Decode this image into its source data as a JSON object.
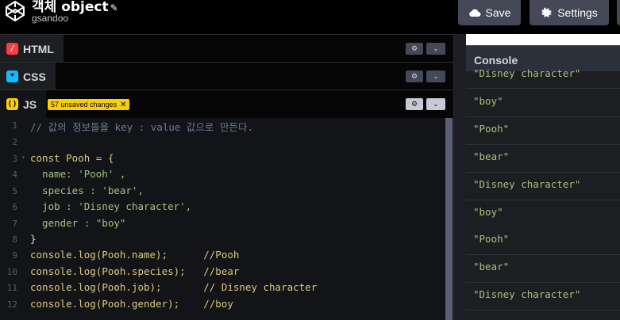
{
  "header": {
    "title": "객체 object",
    "username": "gsandoo",
    "save_label": "Save",
    "settings_label": "Settings"
  },
  "panels": {
    "html": {
      "label": "HTML",
      "icon": "/"
    },
    "css": {
      "label": "CSS",
      "icon": "*"
    },
    "js": {
      "label": "JS",
      "icon": "()",
      "unsaved": "57 unsaved changes"
    }
  },
  "code": {
    "lines": [
      {
        "n": "1",
        "text": "// 값의 정보들을 key : value 값으로 만든다."
      },
      {
        "n": "2",
        "text": ""
      },
      {
        "n": "3",
        "text": "const Pooh = {"
      },
      {
        "n": "4",
        "text": "  name: 'Pooh' ,"
      },
      {
        "n": "5",
        "text": "  species : 'bear',"
      },
      {
        "n": "6",
        "text": "  job : 'Disney character',"
      },
      {
        "n": "7",
        "text": "  gender : \"boy\""
      },
      {
        "n": "8",
        "text": "}"
      },
      {
        "n": "9",
        "text": "console.log(Pooh.name);      //Pooh"
      },
      {
        "n": "10",
        "text": "console.log(Pooh.species);   //bear"
      },
      {
        "n": "11",
        "text": "console.log(Pooh.job);       // Disney character"
      },
      {
        "n": "12",
        "text": "console.log(Pooh.gender);    //boy"
      }
    ]
  },
  "console": {
    "title": "Console",
    "logs": [
      "\"Disney character\"",
      "\"boy\"",
      "\"Pooh\"",
      "\"bear\"",
      "\"Disney character\"",
      "\"boy\"",
      "\"Pooh\"",
      "\"bear\"",
      "\"Disney character\""
    ]
  },
  "colors": {
    "html_icon": "#ff3c41",
    "css_icon": "#0ebeff",
    "js_icon": "#fcd000",
    "string": "#a6c17d",
    "keyword": "#ddca7e"
  }
}
